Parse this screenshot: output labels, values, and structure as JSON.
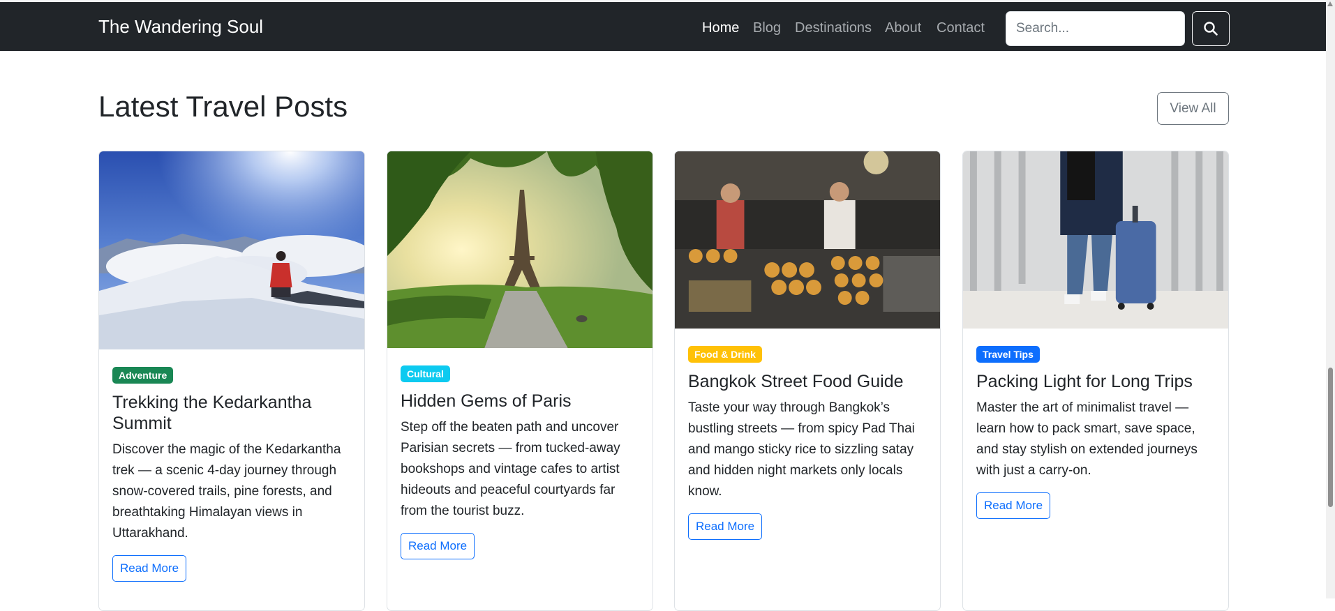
{
  "navbar": {
    "brand": "The Wandering Soul",
    "links": [
      "Home",
      "Blog",
      "Destinations",
      "About",
      "Contact"
    ],
    "search_placeholder": "Search...",
    "search_icon": "search-icon"
  },
  "section": {
    "title": "Latest Travel Posts",
    "view_all": "View All"
  },
  "posts": [
    {
      "category": "Adventure",
      "category_color": "#198754",
      "category_text_color": "#ffffff",
      "title": "Trekking the Kedarkantha Summit",
      "excerpt": "Discover the magic of the Kedarkantha trek — a scenic 4-day journey through snow-covered trails, pine forests, and breathtaking Himalayan views in Uttarakhand.",
      "cta": "Read More"
    },
    {
      "category": "Cultural",
      "category_color": "#0dcaf0",
      "category_text_color": "#ffffff",
      "title": "Hidden Gems of Paris",
      "excerpt": "Step off the beaten path and uncover Parisian secrets — from tucked-away bookshops and vintage cafes to artist hideouts and peaceful courtyards far from the tourist buzz.",
      "cta": "Read More"
    },
    {
      "category": "Food & Drink",
      "category_color": "#ffc107",
      "category_text_color": "#ffffff",
      "title": "Bangkok Street Food Guide",
      "excerpt": "Taste your way through Bangkok’s bustling streets — from spicy Pad Thai and mango sticky rice to sizzling satay and hidden night markets only locals know.",
      "cta": "Read More"
    },
    {
      "category": "Travel Tips",
      "category_color": "#0d6efd",
      "category_text_color": "#ffffff",
      "title": "Packing Light for Long Trips",
      "excerpt": "Master the art of minimalist travel — learn how to pack smart, save space, and stay stylish on extended journeys with just a carry-on.",
      "cta": "Read More"
    }
  ]
}
